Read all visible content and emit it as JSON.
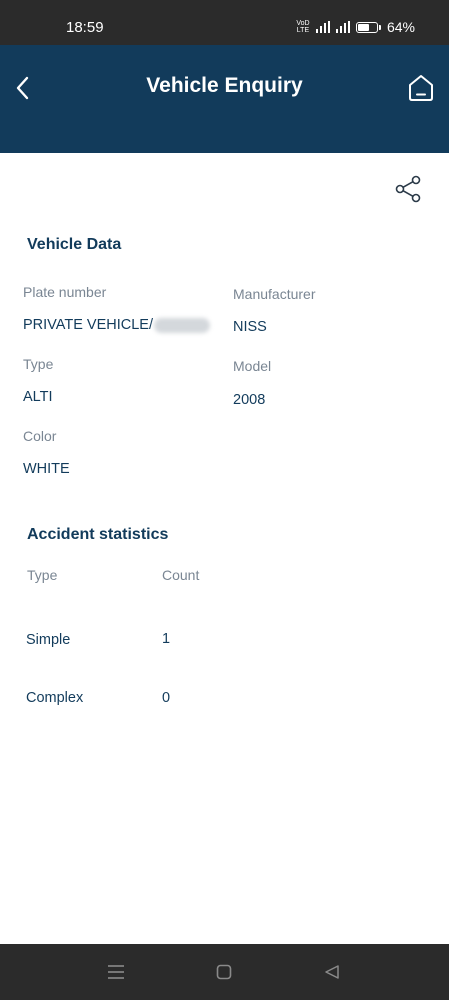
{
  "status_bar": {
    "time": "18:59",
    "network_tag_top": "VoD",
    "network_tag_bottom": "LTE",
    "battery_percent": "64%",
    "battery_level": 0.64,
    "icons": [
      "5g-signal-icon",
      "signal-icon",
      "battery-icon"
    ]
  },
  "header": {
    "title": "Vehicle Enquiry",
    "background": "#123b5b",
    "icons": [
      "back-arrow-icon",
      "home-icon"
    ]
  },
  "share": {
    "icon": "share-icon"
  },
  "vehicle_data": {
    "title": "Vehicle Data",
    "plate_number": {
      "label": "Plate number",
      "value": "PRIVATE VEHICLE/"
    },
    "manufacturer": {
      "label": "Manufacturer",
      "value": "NISS"
    },
    "type": {
      "label": "Type",
      "value": "ALTI"
    },
    "model": {
      "label": "Model",
      "value": "2008"
    },
    "color": {
      "label": "Color",
      "value": "WHITE"
    }
  },
  "accident_statistics": {
    "title": "Accident statistics",
    "columns": [
      "Type",
      "Count"
    ],
    "rows": [
      {
        "type": "Simple",
        "count": "1"
      },
      {
        "type": "Complex",
        "count": "0"
      }
    ]
  },
  "nav_bar": {
    "icons": [
      "menu-icon",
      "home-square-icon",
      "back-triangle-icon"
    ]
  }
}
